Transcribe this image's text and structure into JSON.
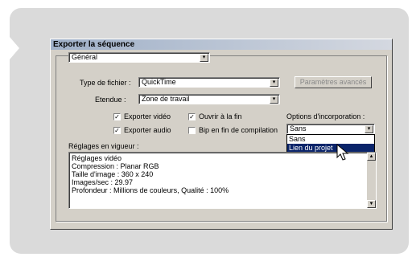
{
  "dialog": {
    "title": "Exporter la séquence"
  },
  "general": {
    "value": "Général"
  },
  "file_type": {
    "label": "Type de fichier :",
    "value": "QuickTime",
    "advanced_button": "Paramètres avancés"
  },
  "range": {
    "label": "Etendue :",
    "value": "Zone de travail"
  },
  "checkboxes": {
    "export_video": {
      "label": "Exporter vidéo",
      "checked": "☑"
    },
    "open_at_end": {
      "label": "Ouvrir à la fin",
      "checked": "☑"
    },
    "export_audio": {
      "label": "Exporter audio",
      "checked": "☑"
    },
    "beep_at_end": {
      "label": "Bip en fin de compilation",
      "checked": ""
    }
  },
  "embed_options": {
    "label": "Options d'incorporation :",
    "value": "Sans",
    "options": [
      "Sans",
      "Lien du projet"
    ]
  },
  "settings": {
    "label": "Réglages en vigueur :",
    "lines": [
      "Réglages vidéo",
      "Compression : Planar RGB",
      "Taille d'image : 360 x 240",
      "Images/sec : 29.97",
      "Profondeur : Millions de couleurs, Qualité : 100%"
    ]
  },
  "icons": {
    "dropdown": "▾",
    "scroll_up": "▲",
    "scroll_down": "▼",
    "check": "✓"
  }
}
